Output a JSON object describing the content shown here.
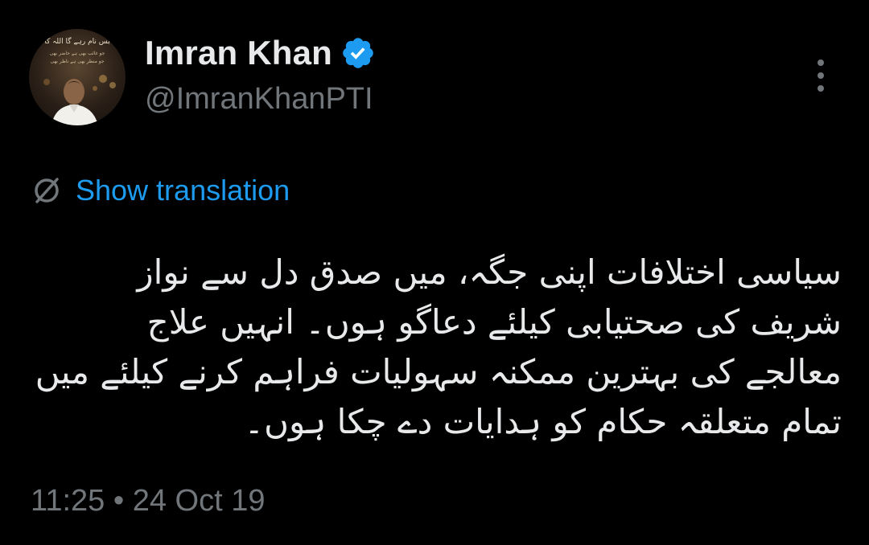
{
  "author": {
    "display_name": "Imran Khan",
    "handle": "@ImranKhanPTI",
    "verified": true,
    "avatar_caption_lines": [
      "بس نام رہے گا اللہ کا",
      "جو غائب بھی ہے حاضر بھی",
      "جو منظر بھی ہے ناظر بھی"
    ]
  },
  "translate": {
    "icon": "globe-icon",
    "label": "Show translation"
  },
  "tweet": {
    "text": "سیاسی اختلافات اپنی جگہ، میں صدق دل سے نواز\nشریف کی صحتیابی کیلئے دعاگو ہوں۔ انہیں علاج\nمعالجے کی بہترین ممکنہ سہولیات فراہم کرنے کیلئے میں\nتمام متعلقہ حکام کو ہدایات دے چکا ہوں۔"
  },
  "footer": {
    "timestamp": "11:25 • 24 Oct 19"
  },
  "colors": {
    "background": "#000000",
    "text_primary": "#e7e9ea",
    "text_secondary": "#71767b",
    "accent": "#1d9bf0"
  }
}
